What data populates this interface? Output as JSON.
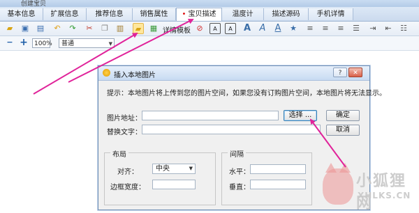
{
  "window": {
    "title": "创建宝贝"
  },
  "tabs": [
    {
      "label": "基本信息",
      "active": false
    },
    {
      "label": "扩展信息",
      "active": false
    },
    {
      "label": "推荐信息",
      "active": false
    },
    {
      "label": "销售属性",
      "active": false
    },
    {
      "label": "宝贝描述",
      "active": true,
      "marker": "•"
    },
    {
      "label": "温度计",
      "active": false
    },
    {
      "label": "描述源码",
      "active": false
    },
    {
      "label": "手机详情",
      "active": false
    }
  ],
  "toolbar": {
    "details_label": "详情模板",
    "icons": [
      "open-folder-icon",
      "save-icon",
      "save-as-icon",
      "undo-icon",
      "redo-icon",
      "cut-icon",
      "copy-icon",
      "paste-icon",
      "insert-image-icon",
      "insert-web-image-icon",
      "stop-icon",
      "text-box-icon",
      "text-box-alt-icon",
      "font-a-icon",
      "italic-a-icon",
      "underline-a-icon",
      "star-icon",
      "align-left-icon",
      "align-center-icon",
      "align-right-icon",
      "justify-icon",
      "indent-icon",
      "outdent-icon",
      "list-icon"
    ]
  },
  "toolbar2": {
    "zoom_out": "−",
    "zoom_in": "+",
    "zoom_value": "100%",
    "format_value": "普通"
  },
  "dialog": {
    "title": "插入本地图片",
    "help": "?",
    "close": "✕",
    "tip": "提示：本地图片将上传到您的图片空间，如果您没有订购图片空间，本地图片将无法显示。",
    "image_address_label": "图片地址：",
    "image_address_value": "",
    "alt_text_label": "替换文字：",
    "alt_text_value": "",
    "browse_button": "选择 ...",
    "ok_button": "确定",
    "cancel_button": "取消",
    "layout_group": "布局",
    "align_label": "对齐：",
    "align_value": "中央",
    "border_label": "边框宽度：",
    "border_value": "",
    "spacing_group": "间隔",
    "horizontal_label": "水平：",
    "horizontal_value": "",
    "vertical_label": "垂直：",
    "vertical_value": ""
  },
  "watermark": {
    "text_cn": "小狐狸网",
    "text_en": "XHLKS.CN"
  },
  "colors": {
    "arrow": "#e0239a",
    "tab_marker": "#dd0000"
  }
}
